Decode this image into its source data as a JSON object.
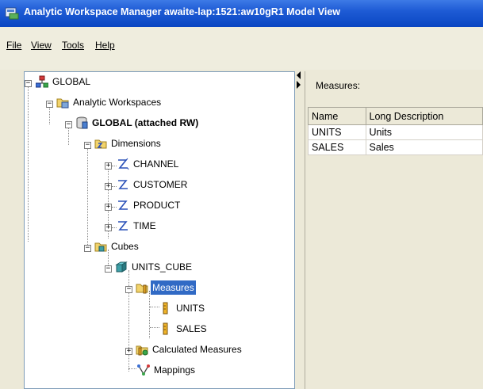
{
  "window": {
    "title": "Analytic Workspace Manager   awaite-lap:1521:aw10gR1   Model View",
    "accent_color": "#0a46c2",
    "icon": "awm-app-icon"
  },
  "menu": [
    {
      "label": "File"
    },
    {
      "label": "View"
    },
    {
      "label": "Tools"
    },
    {
      "label": "Help"
    }
  ],
  "tree": {
    "items": [
      {
        "label": "GLOBAL",
        "icon": "connection-icon",
        "level": 0,
        "expanded": true
      },
      {
        "label": "Analytic Workspaces",
        "icon": "workspaces-folder-icon",
        "level": 1,
        "expanded": true
      },
      {
        "label": "GLOBAL (attached RW)",
        "icon": "database-icon",
        "level": 2,
        "expanded": true,
        "bold": true
      },
      {
        "label": "Dimensions",
        "icon": "dimensions-folder-icon",
        "level": 3,
        "expanded": true
      },
      {
        "label": "CHANNEL",
        "icon": "dimension-icon",
        "level": 4,
        "expanded": false
      },
      {
        "label": "CUSTOMER",
        "icon": "dimension-icon",
        "level": 4,
        "expanded": false
      },
      {
        "label": "PRODUCT",
        "icon": "dimension-icon",
        "level": 4,
        "expanded": false
      },
      {
        "label": "TIME",
        "icon": "dimension-icon",
        "level": 4,
        "expanded": false
      },
      {
        "label": "Cubes",
        "icon": "cubes-folder-icon",
        "level": 3,
        "expanded": true
      },
      {
        "label": "UNITS_CUBE",
        "icon": "cube-icon",
        "level": 4,
        "expanded": true
      },
      {
        "label": "Measures",
        "icon": "measures-folder-icon",
        "level": 5,
        "expanded": true,
        "selected": true
      },
      {
        "label": "UNITS",
        "icon": "measure-icon",
        "level": 6
      },
      {
        "label": "SALES",
        "icon": "measure-icon",
        "level": 6
      },
      {
        "label": "Calculated Measures",
        "icon": "calculated-measures-icon",
        "level": 5,
        "expanded": false
      },
      {
        "label": "Mappings",
        "icon": "mappings-icon",
        "level": 5
      }
    ],
    "selection_color": "#316ac5"
  },
  "measures_panel": {
    "label": "Measures:",
    "columns": [
      "Name",
      "Long Description"
    ],
    "rows": [
      [
        "UNITS",
        "Units"
      ],
      [
        "SALES",
        "Sales"
      ]
    ]
  }
}
